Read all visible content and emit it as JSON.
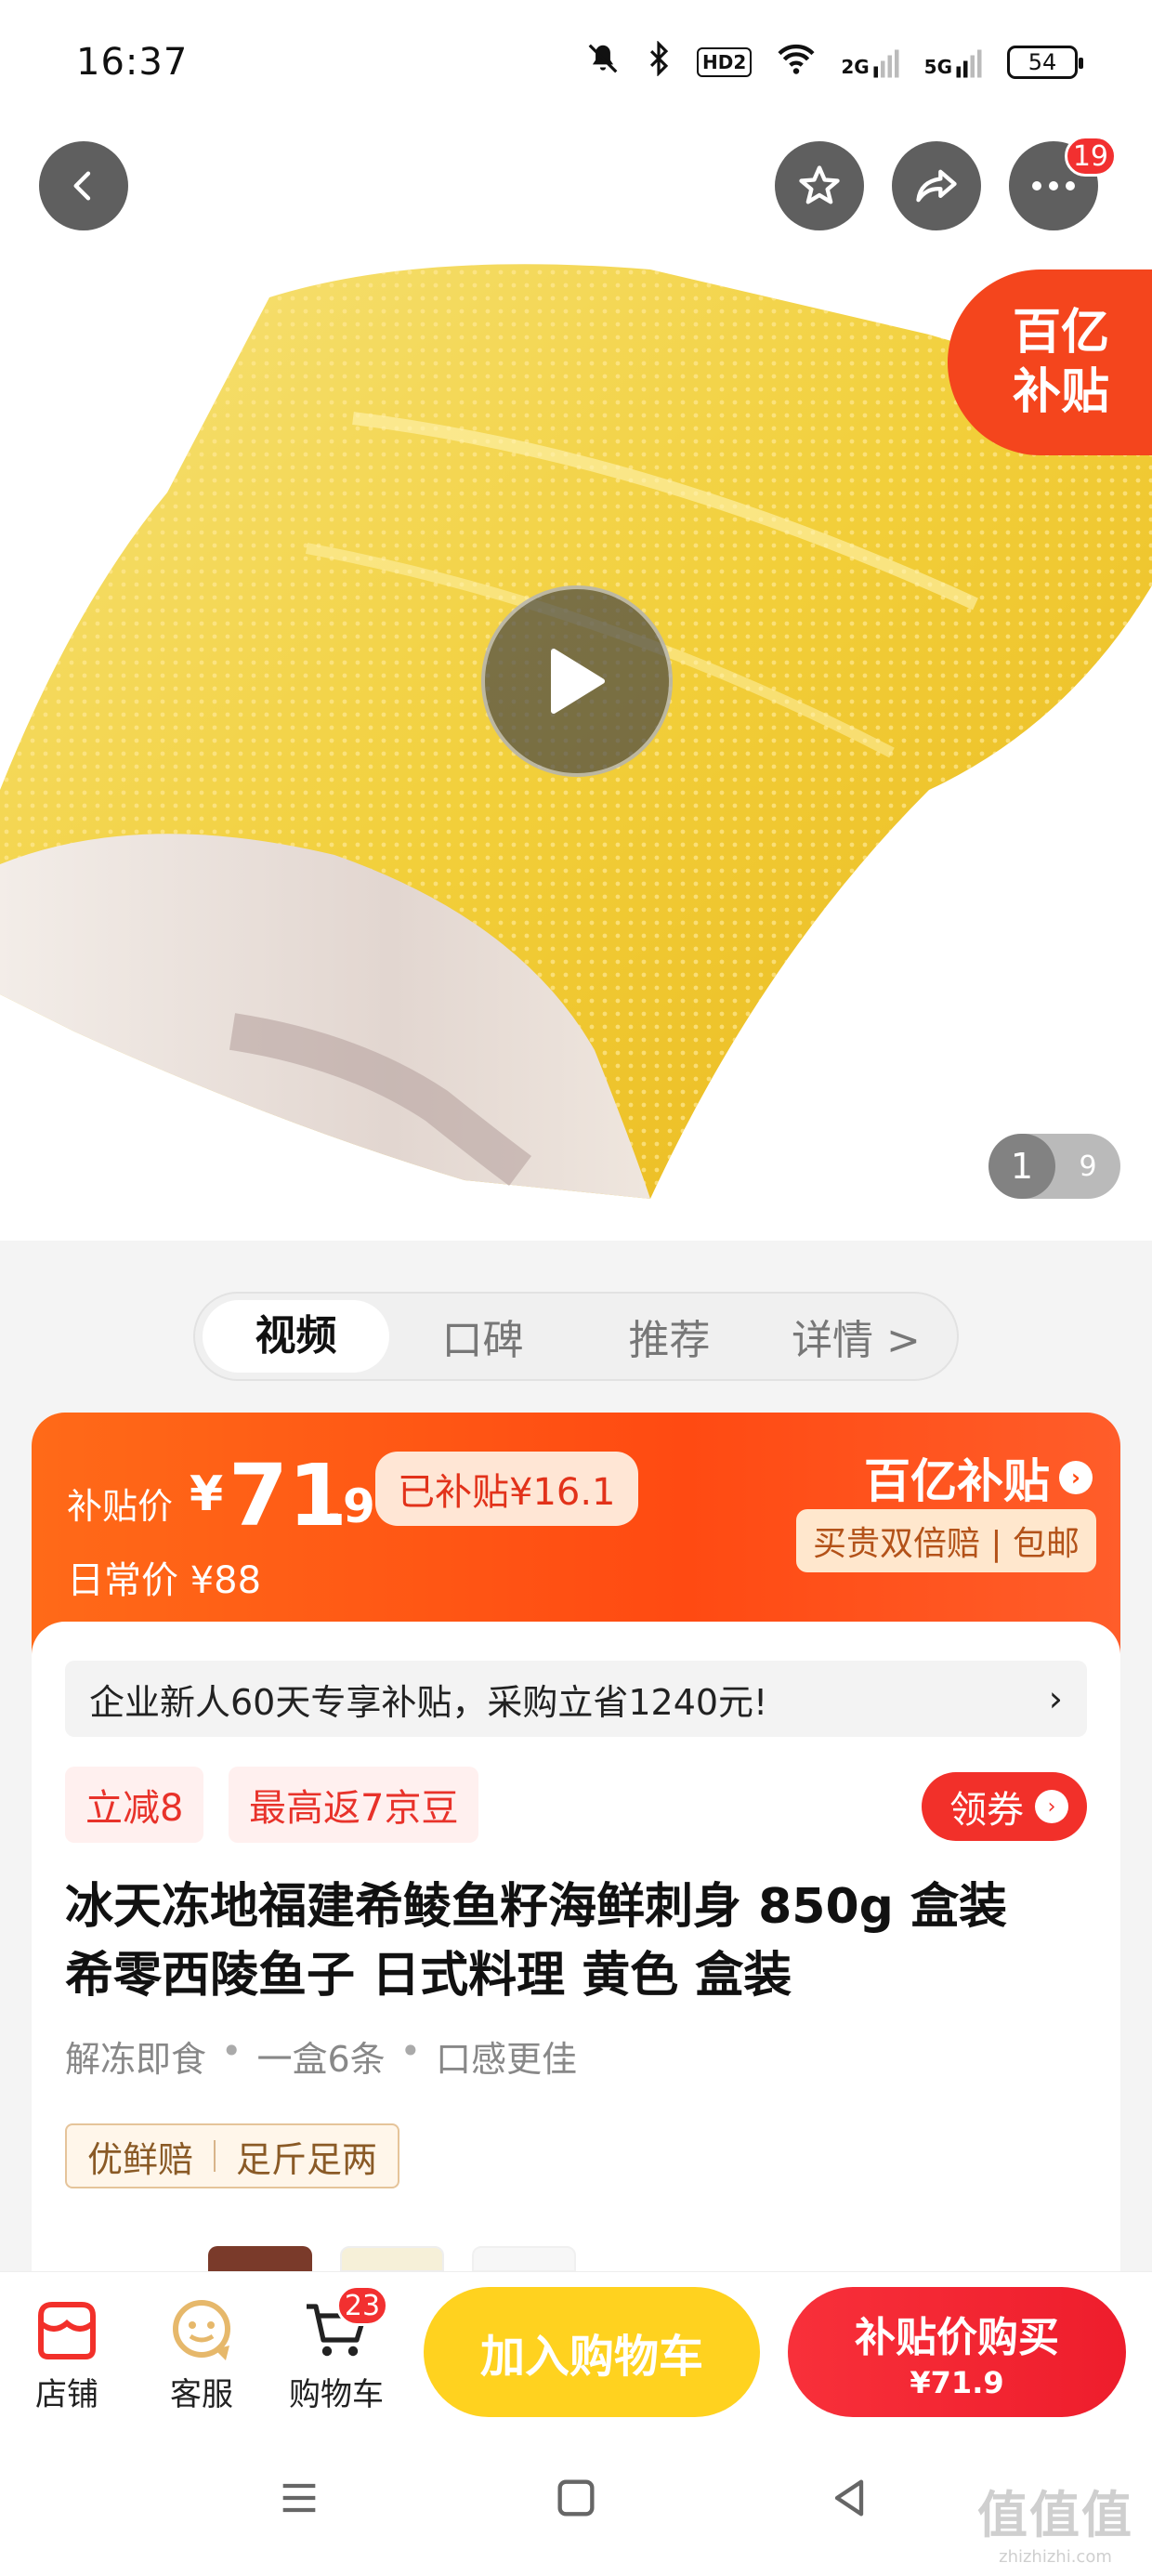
{
  "status_bar": {
    "time": "16:37",
    "hd_label": "HD2",
    "signal_2g": "2G",
    "signal_5g": "5G",
    "battery": "54"
  },
  "header": {
    "more_badge": "19"
  },
  "hero": {
    "subsidy_tag_line1": "百亿",
    "subsidy_tag_line2": "补贴",
    "pager_current": "1",
    "pager_total": "9"
  },
  "tabs": [
    {
      "label": "视频"
    },
    {
      "label": "口碑"
    },
    {
      "label": "推荐"
    },
    {
      "label": "详情 >"
    }
  ],
  "price": {
    "label": "补贴价",
    "currency": "¥",
    "integer": "71",
    "decimal": ".9",
    "already_subsidized": "已补贴¥16.1",
    "regular": "日常价 ¥88",
    "brand": "百亿补贴",
    "guarantee": "买贵双倍赔 | 包邮"
  },
  "promo": {
    "text": "企业新人60天专享补贴，采购立省1240元!",
    "arrow": "›"
  },
  "coupons": {
    "chip1": "立减8",
    "chip2": "最高返7京豆",
    "get_coupon": "领券"
  },
  "product": {
    "title_line1": "冰天冻地福建希鲮鱼籽海鲜刺身 850g 盒装",
    "title_line2": "希零西陵鱼子 日式料理 黄色 盒装",
    "features": [
      "解冻即食",
      "一盒6条",
      "口感更佳"
    ],
    "service1": "优鲜赔",
    "service2": "足斤足两"
  },
  "actionbar": {
    "store": "店铺",
    "service": "客服",
    "cart": "购物车",
    "cart_badge": "23",
    "add_to_cart": "加入购物车",
    "buy_line1": "补贴价购买",
    "buy_line2": "¥71.9"
  },
  "watermark": {
    "line1": "值值值",
    "line2": "zhizhizhi.com"
  },
  "colors": {
    "accent_orange": "#ff4a12",
    "accent_red": "#f2302a",
    "accent_yellow": "#ffd21f"
  }
}
